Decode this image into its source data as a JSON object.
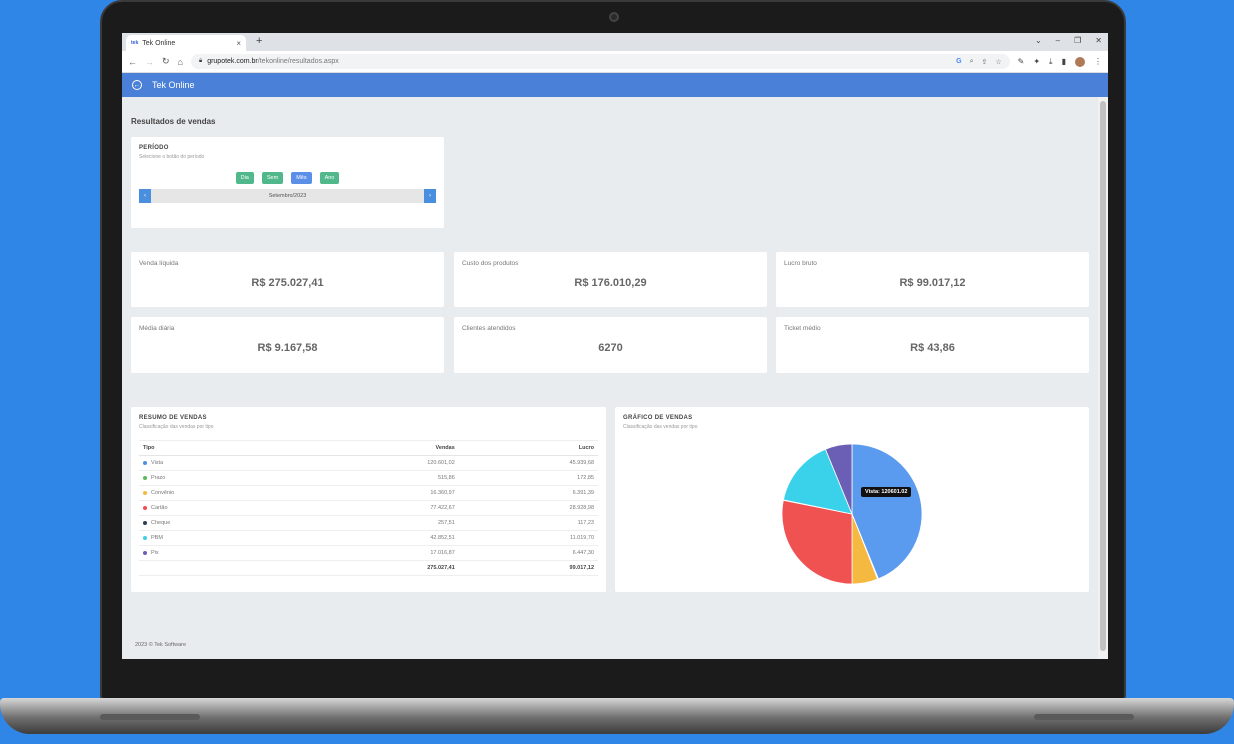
{
  "browser": {
    "tab_title": "Tek Online",
    "url_domain": "grupotek.com.br",
    "url_path": "/tekonline/resultados.aspx"
  },
  "app": {
    "title": "Tek Online",
    "page_title": "Resultados de vendas",
    "footer": "2023 © Tek Software"
  },
  "period": {
    "title": "PERÍODO",
    "subtitle": "Selecione o botão do período",
    "buttons": [
      "Dia",
      "Sem",
      "Mês",
      "Ano"
    ],
    "active": "Mês",
    "current": "Setembro/2023"
  },
  "stats": [
    {
      "label": "Venda líquida",
      "value": "R$ 275.027,41"
    },
    {
      "label": "Custo dos produtos",
      "value": "R$ 176.010,29"
    },
    {
      "label": "Lucro bruto",
      "value": "R$ 99.017,12"
    },
    {
      "label": "Média diária",
      "value": "R$ 9.167,58"
    },
    {
      "label": "Clientes atendidos",
      "value": "6270"
    },
    {
      "label": "Ticket médio",
      "value": "R$ 43,86"
    }
  ],
  "summary": {
    "title": "RESUMO DE VENDAS",
    "subtitle": "Classificação das vendas por tipo",
    "headers": {
      "tipo": "Tipo",
      "vendas": "Vendas",
      "lucro": "Lucro"
    },
    "rows": [
      {
        "tipo": "Vista",
        "vendas": "120.601,02",
        "lucro": "45.939,68",
        "color": "#4e8fe6"
      },
      {
        "tipo": "Prazo",
        "vendas": "515,86",
        "lucro": "172,85",
        "color": "#5cb85c"
      },
      {
        "tipo": "Convênio",
        "vendas": "16.360,97",
        "lucro": "6.391,39",
        "color": "#f5b841"
      },
      {
        "tipo": "Cartão",
        "vendas": "77.422,67",
        "lucro": "28.928,98",
        "color": "#ef4f4f"
      },
      {
        "tipo": "Cheque",
        "vendas": "257,51",
        "lucro": "117,23",
        "color": "#2c3e50"
      },
      {
        "tipo": "PBM",
        "vendas": "42.852,51",
        "lucro": "11.019,70",
        "color": "#3ecfe6"
      },
      {
        "tipo": "Pix",
        "vendas": "17.016,87",
        "lucro": "6.447,30",
        "color": "#6c5fb8"
      }
    ],
    "total_vendas": "275.027,41",
    "total_lucro": "99.017,12"
  },
  "chart_panel": {
    "title": "GRÁFICO DE VENDAS",
    "subtitle": "Classificação das vendas por tipo",
    "tooltip": "Vista: 120601.02"
  },
  "chart_data": {
    "type": "pie",
    "categories": [
      "Vista",
      "Prazo",
      "Convênio",
      "Cartão",
      "Cheque",
      "PBM",
      "Pix"
    ],
    "values": [
      120601.02,
      515.86,
      16360.97,
      77422.67,
      257.51,
      42852.51,
      17016.87
    ],
    "colors": [
      "#5b9bef",
      "#5cb85c",
      "#f5b841",
      "#f05252",
      "#2c3e50",
      "#3ad1eb",
      "#6b5fb5"
    ]
  }
}
